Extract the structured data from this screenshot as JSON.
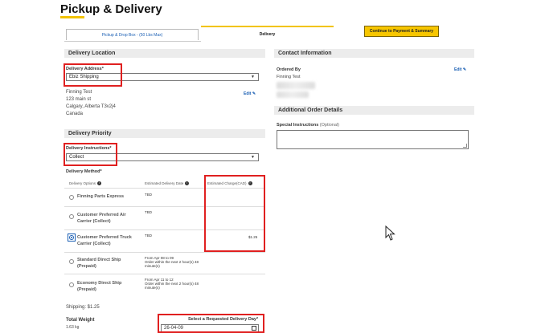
{
  "page": {
    "title": "Pickup & Delivery"
  },
  "tabs": {
    "pickup": "Pickup & Drop Box - (50 Lbs Max)",
    "delivery": "Delivery",
    "continue": "Continue to Payment & Summary"
  },
  "delivery_location": {
    "header": "Delivery Location",
    "address_label": "Delivery Address*",
    "address_value": "Ebiz Shipping",
    "address_lines": [
      "Finning Test",
      "123 main st",
      "Calgary, Alberta T3v2j4",
      "Canada"
    ],
    "edit": "Edit"
  },
  "delivery_priority": {
    "header": "Delivery Priority",
    "instructions_label": "Delivery Instructions*",
    "instructions_value": "Collect",
    "method_label": "Delivery Method*",
    "columns": [
      "Delivery Options",
      "Estimated Delivery Date",
      "Estimated Charge(CAD)"
    ],
    "options": [
      {
        "name": "Finning Parts Express",
        "date": "TBD",
        "charge": "",
        "selected": false
      },
      {
        "name": "Customer Preferred Air Carrier (Collect)",
        "date": "TBD",
        "charge": "",
        "selected": false
      },
      {
        "name": "Customer Preferred Truck Carrier (Collect)",
        "date": "TBD",
        "charge": "$1.25",
        "selected": true
      },
      {
        "name": "Standard Direct Ship (Prepaid)",
        "date": "From Apr 08 to 09\nOrder within the next 2 hour(s) 48 minute(s)",
        "charge": "",
        "selected": false
      },
      {
        "name": "Economy Direct Ship (Prepaid)",
        "date": "From Apr 11 to 12\nOrder within the next 2 hour(s) 48 minute(s)",
        "charge": "",
        "selected": false
      }
    ],
    "shipping": "Shipping: $1.25",
    "total_weight_label": "Total Weight",
    "total_weight_value": "1.63 kg",
    "requested_day_label": "Select a Requested Delivery Day*",
    "requested_day_value": "26-04-09"
  },
  "contact": {
    "header": "Contact Information",
    "ordered_by_label": "Ordered By",
    "ordered_by_value": "Finning Test",
    "edit": "Edit"
  },
  "additional": {
    "header": "Additional Order Details",
    "instructions_label": "Special Instructions",
    "instructions_hint": "(Optional)"
  },
  "colors": {
    "accent": "#f2c300",
    "link": "#1a5fb4",
    "highlight": "#e02020"
  }
}
